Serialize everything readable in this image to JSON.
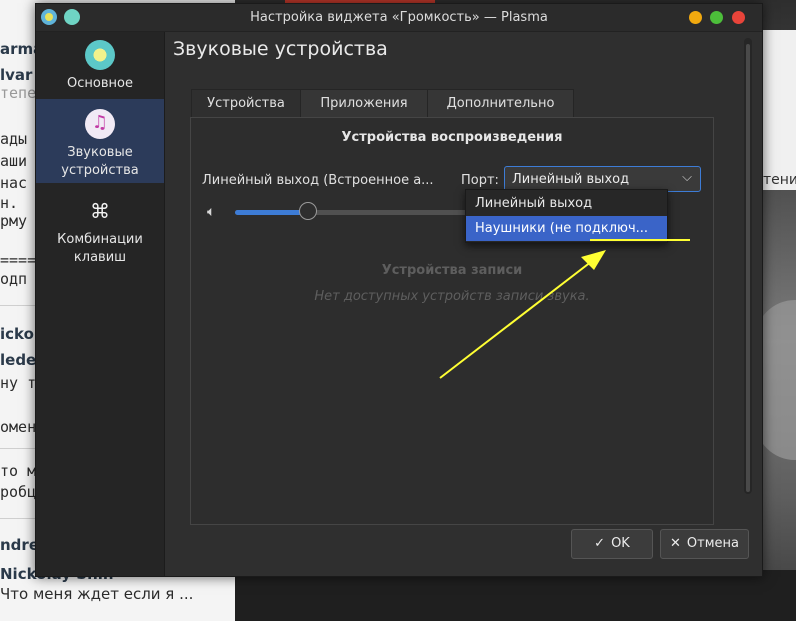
{
  "background": {
    "left_lines": [
      "arma",
      "lvar",
      "тепе",
      "ады",
      "аши",
      "нас",
      "н.",
      "рму",
      "====",
      "одп",
      "icko",
      "lede",
      "ну т",
      "омен",
      "то м",
      "робц",
      "ndre",
      "Nickolay Shin",
      "Что меня ждет если я ..."
    ],
    "right_strip_text": "тение"
  },
  "window": {
    "title": "Настройка виджета «Громкость» — Plasma",
    "sidebar": [
      {
        "label": "Основное",
        "icon": "general-icon"
      },
      {
        "label": "Звуковые устройства",
        "icon": "audio-devices-icon"
      },
      {
        "label": "Комбинации клавиш",
        "icon": "keyboard-shortcuts-icon"
      }
    ],
    "page_title": "Звуковые устройства",
    "tabs": [
      "Устройства",
      "Приложения",
      "Дополнительно"
    ],
    "active_tab": "Устройства",
    "playback": {
      "heading": "Устройства воспроизведения",
      "device_name": "Линейный выход (Встроенное а...",
      "port_label": "Порт:",
      "port_value": "Линейный выход",
      "port_options": [
        "Линейный выход",
        "Наушники (не подключ..."
      ],
      "highlighted_option": "Наушники (не подключ...",
      "volume_fraction": 0.27
    },
    "recording": {
      "heading": "Устройства записи",
      "empty_text": "Нет доступных устройств записи звука."
    },
    "buttons": {
      "ok": "OK",
      "cancel": "Отмена"
    },
    "colors": {
      "accent": "#3d7cd6",
      "annotation": "#ffff33"
    }
  }
}
